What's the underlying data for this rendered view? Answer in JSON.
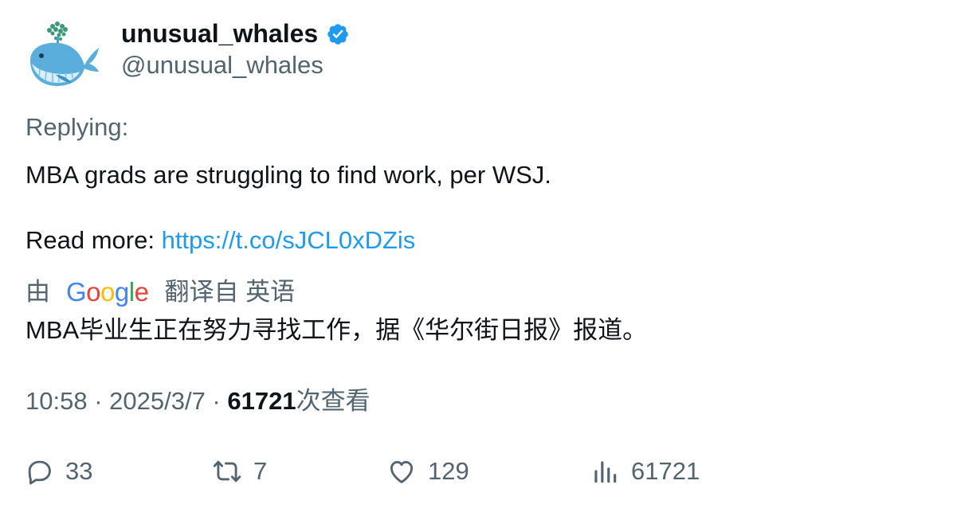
{
  "author": {
    "display_name": "unusual_whales",
    "handle": "@unusual_whales",
    "verified": true,
    "avatar_icon": "whale-avatar"
  },
  "tweet": {
    "replying_label": "Replying:",
    "text": "MBA grads are struggling to find work, per WSJ.",
    "read_more_label": "Read more: ",
    "link": "https://t.co/sJCL0xDZis"
  },
  "translation": {
    "by_label": "由",
    "provider": "Google",
    "translated_from_label": "翻译自 英语",
    "text": "MBA毕业生正在努力寻找工作，据《华尔街日报》报道。"
  },
  "meta": {
    "time": "10:58",
    "date": "2025/3/7",
    "separator": " · ",
    "views_count": "61721",
    "views_label": "次查看"
  },
  "actions": {
    "reply_count": "33",
    "retweet_count": "7",
    "like_count": "129",
    "views_count": "61721"
  },
  "colors": {
    "link": "#1d9bf0",
    "secondary_text": "#536471",
    "primary_text": "#0f1419",
    "verified_badge": "#1d9bf0"
  }
}
